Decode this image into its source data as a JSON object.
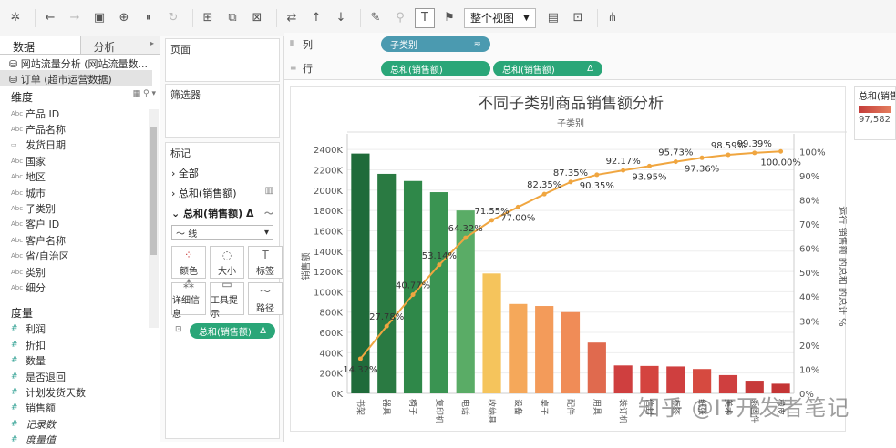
{
  "toolbar": {
    "view_label": "整个视图"
  },
  "left": {
    "tab_data": "数据",
    "tab_analysis": "分析",
    "datasource_1": "网站流量分析 (网站流量数...",
    "datasource_2": "订单 (超市运营数据)",
    "dimensions_header": "维度",
    "dimensions": [
      "产品 ID",
      "产品名称",
      "发货日期",
      "国家",
      "地区",
      "城市",
      "子类别",
      "客户 ID",
      "客户名称",
      "省/自治区",
      "类别",
      "细分"
    ],
    "dimension_icons": [
      "Abc",
      "Abc",
      "date",
      "Abc",
      "Abc",
      "Abc",
      "Abc",
      "Abc",
      "Abc",
      "Abc",
      "Abc",
      "Abc"
    ],
    "measures_header": "度量",
    "measures": [
      "利润",
      "折扣",
      "数量",
      "是否退回",
      "计划发货天数",
      "销售额"
    ],
    "italic_fields": [
      "记录数",
      "度量值"
    ]
  },
  "mid": {
    "pages_label": "页面",
    "filters_label": "筛选器",
    "marks_label": "标记",
    "all_label": "全部",
    "sum_sales_1": "总和(销售额)",
    "sum_sales_2": "总和(销售额)",
    "mark_type": "线",
    "color_label": "颜色",
    "size_label": "大小",
    "label_label": "标签",
    "detail_label": "详细信息",
    "tooltip_label": "工具提示",
    "path_label": "路径",
    "path_pill": "总和(销售额)"
  },
  "shelves": {
    "columns_label": "列",
    "rows_label": "行",
    "col_pill": "子类别",
    "row_pill_1": "总和(销售额)",
    "row_pill_2": "总和(销售额)"
  },
  "legend": {
    "title": "总和(销售额)",
    "value": "97,582"
  },
  "watermark": "知乎 @IT开发者笔记",
  "chart_data": {
    "type": "bar",
    "title": "不同子类别商品销售额分析",
    "xlabel": "子类别",
    "ylabel": "销售额",
    "y2label": "运行 销售额 的总和 的总计 %",
    "ylim": [
      0,
      2500000
    ],
    "y_ticks": [
      "0K",
      "200K",
      "400K",
      "600K",
      "800K",
      "1000K",
      "1200K",
      "1400K",
      "1600K",
      "1800K",
      "2000K",
      "2200K",
      "2400K"
    ],
    "y2lim": [
      0,
      1.05
    ],
    "y2_ticks": [
      "0%",
      "10%",
      "20%",
      "30%",
      "40%",
      "50%",
      "60%",
      "70%",
      "80%",
      "90%",
      "100%"
    ],
    "categories": [
      "书架",
      "器具",
      "椅子",
      "复印机",
      "电话",
      "收纳具",
      "设备",
      "桌子",
      "配件",
      "用具",
      "装订机",
      "信封",
      "标签",
      "纸张",
      "美术",
      "系固件",
      "橡皮"
    ],
    "values": [
      2360000,
      2160000,
      2090000,
      1980000,
      1800000,
      1180000,
      880000,
      860000,
      800000,
      500000,
      275000,
      270000,
      265000,
      240000,
      180000,
      125000,
      95000
    ],
    "bar_colors": [
      "#1f6b3a",
      "#2a7a42",
      "#2f8849",
      "#3a9452",
      "#5aac66",
      "#f5c45c",
      "#f5a85a",
      "#f39b5a",
      "#f08c57",
      "#e06a4e",
      "#cf3f3f",
      "#d4443f",
      "#cf3f3f",
      "#d64a40",
      "#cf3f3f",
      "#c73a3a",
      "#c43535"
    ],
    "line_series": {
      "name": "运行 销售额 的总和 的总计 %",
      "color": "#f0a640",
      "values": [
        0.1432,
        0.2778,
        0.4077,
        0.5314,
        0.6432,
        0.7155,
        0.77,
        0.8235,
        0.8735,
        0.9035,
        0.9217,
        0.9395,
        0.9573,
        0.9736,
        0.9859,
        0.9939,
        1.0
      ],
      "labels": [
        "14.32%",
        "27.78%",
        "40.77%",
        "53.14%",
        "64.32%",
        "71.55%",
        "77.00%",
        "82.35%",
        "87.35%",
        "90.35%",
        "92.17%",
        "93.95%",
        "95.73%",
        "97.36%",
        "98.59%",
        "99.39%",
        "100.00%"
      ],
      "label_pos": [
        "below",
        "above",
        "above",
        "above",
        "above",
        "above",
        "below",
        "above",
        "above",
        "below",
        "above",
        "below",
        "above",
        "below",
        "above",
        "above",
        "below"
      ]
    },
    "grid": true
  }
}
